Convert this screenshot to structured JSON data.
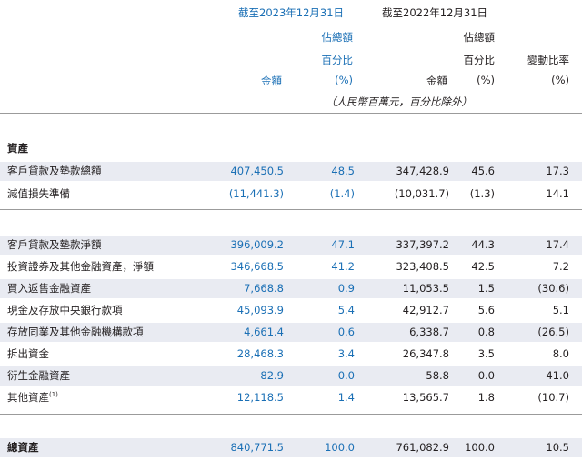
{
  "header": {
    "period_2023": "截至2023年12月31日",
    "period_2022": "截至2022年12月31日",
    "col_amount_2023": "金額",
    "col_pct_2023_l1": "佔總額",
    "col_pct_2023_l2": "百分比",
    "col_pct_2023_l3": "(%)",
    "col_amount_2022": "金額",
    "col_pct_2022_l1": "佔總額",
    "col_pct_2022_l2": "百分比",
    "col_pct_2022_l3": "(%)",
    "col_change_l1": "變動比率",
    "col_change_l2": "(%)",
    "unit_note": "（人民幣百萬元，百分比除外）"
  },
  "section_title": "資產",
  "rows_group1": [
    {
      "label": "客戶貸款及墊款總額",
      "a2023": "407,450.5",
      "p2023": "48.5",
      "a2022": "347,428.9",
      "p2022": "45.6",
      "chg": "17.3"
    },
    {
      "label": "減值損失準備",
      "a2023": "(11,441.3)",
      "p2023": "(1.4)",
      "a2022": "(10,031.7)",
      "p2022": "(1.3)",
      "chg": "14.1"
    }
  ],
  "rows_group2": [
    {
      "label": "客戶貸款及墊款淨額",
      "sup": "",
      "a2023": "396,009.2",
      "p2023": "47.1",
      "a2022": "337,397.2",
      "p2022": "44.3",
      "chg": "17.4"
    },
    {
      "label": "投資證券及其他金融資產，淨額",
      "sup": "",
      "a2023": "346,668.5",
      "p2023": "41.2",
      "a2022": "323,408.5",
      "p2022": "42.5",
      "chg": "7.2"
    },
    {
      "label": "買入返售金融資產",
      "sup": "",
      "a2023": "7,668.8",
      "p2023": "0.9",
      "a2022": "11,053.5",
      "p2022": "1.5",
      "chg": "(30.6)"
    },
    {
      "label": "現金及存放中央銀行款項",
      "sup": "",
      "a2023": "45,093.9",
      "p2023": "5.4",
      "a2022": "42,912.7",
      "p2022": "5.6",
      "chg": "5.1"
    },
    {
      "label": "存放同業及其他金融機構款項",
      "sup": "",
      "a2023": "4,661.4",
      "p2023": "0.6",
      "a2022": "6,338.7",
      "p2022": "0.8",
      "chg": "(26.5)"
    },
    {
      "label": "拆出資金",
      "sup": "",
      "a2023": "28,468.3",
      "p2023": "3.4",
      "a2022": "26,347.8",
      "p2022": "3.5",
      "chg": "8.0"
    },
    {
      "label": "衍生金融資產",
      "sup": "",
      "a2023": "82.9",
      "p2023": "0.0",
      "a2022": "58.8",
      "p2022": "0.0",
      "chg": "41.0"
    },
    {
      "label": "其他資產",
      "sup": "(1)",
      "a2023": "12,118.5",
      "p2023": "1.4",
      "a2022": "13,565.7",
      "p2022": "1.8",
      "chg": "(10.7)"
    }
  ],
  "total": {
    "label": "總資產",
    "a2023": "840,771.5",
    "p2023": "100.0",
    "a2022": "761,082.9",
    "p2022": "100.0",
    "chg": "10.5"
  },
  "colors": {
    "accent_blue": "#1a6fb5",
    "row_shade": "#e9ebf2"
  }
}
